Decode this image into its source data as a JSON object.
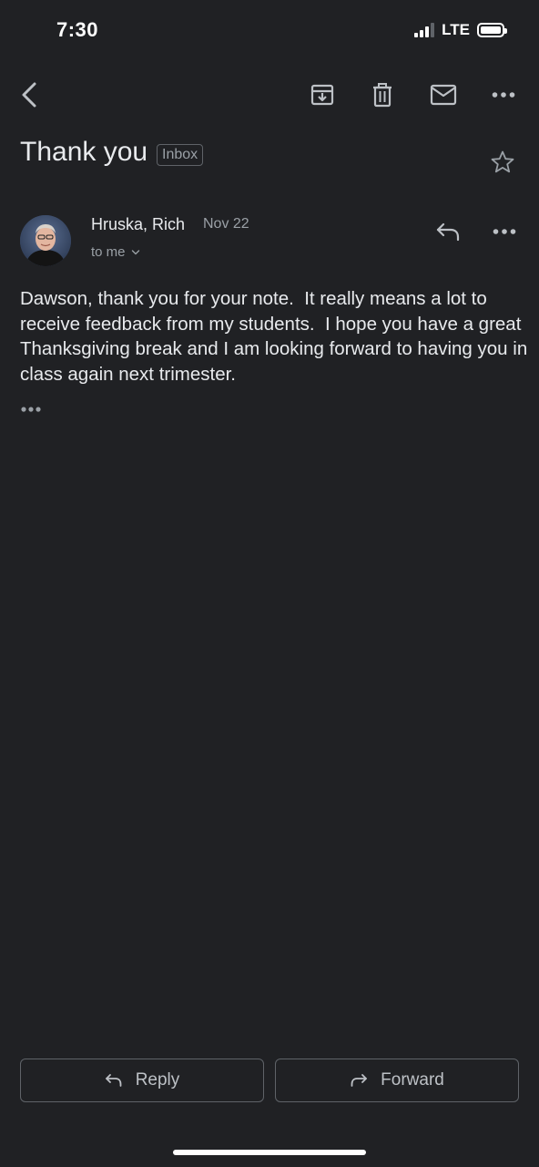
{
  "status_bar": {
    "time": "7:30",
    "network": "LTE",
    "signal_bars": 3,
    "signal_max": 4,
    "battery_level": 1.0
  },
  "toolbar": {
    "back_icon": "back-arrow-icon",
    "archive_icon": "archive-icon",
    "delete_icon": "trash-icon",
    "mark_unread_icon": "mail-icon",
    "more_icon": "more-horizontal-icon"
  },
  "message": {
    "subject": "Thank you",
    "label": "Inbox",
    "starred": false,
    "sender": {
      "name": "Hruska, Rich",
      "date": "Nov 22",
      "recipient_summary": "to me"
    },
    "body": "Dawson, thank you for your note.  It really means a lot to receive feedback from my students.  I hope you have a great Thanksgiving break and I am looking forward to having you in class again next trimester."
  },
  "actions": {
    "reply_label": "Reply",
    "forward_label": "Forward"
  },
  "colors": {
    "background": "#202124",
    "text_primary": "#e8eaed",
    "text_secondary": "#9aa0a6",
    "border": "#5f6368"
  }
}
